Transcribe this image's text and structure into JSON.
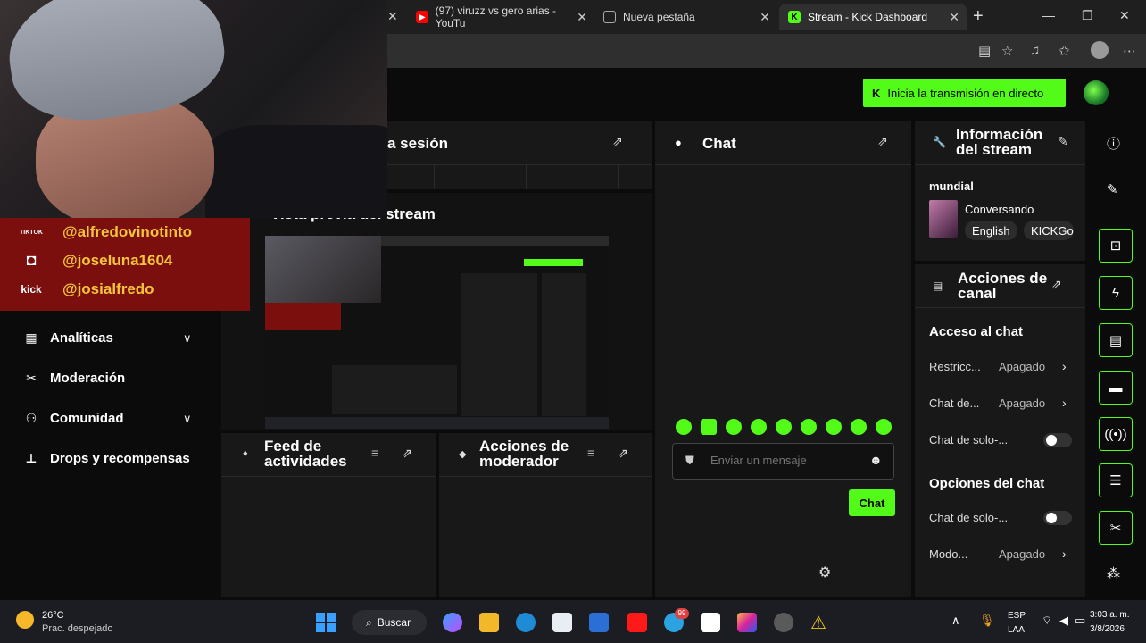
{
  "browser": {
    "tabs": [
      {
        "title": "(97) viruzz vs gero arias - YouTu"
      },
      {
        "title": "Nueva pestaña"
      },
      {
        "title": "Stream - Kick Dashboard"
      }
    ]
  },
  "header": {
    "go_live_label": "Inicia la transmisión en directo"
  },
  "sidebar": {
    "items": [
      {
        "label": "Analíticas",
        "expandable": true
      },
      {
        "label": "Moderación",
        "expandable": false
      },
      {
        "label": "Comunidad",
        "expandable": true
      },
      {
        "label": "Drops y recompensas",
        "expandable": false
      }
    ]
  },
  "panels": {
    "session_title": "a sesión",
    "preview_title": "Vista previa del stream",
    "chat_title": "Chat",
    "activity_title": "Feed de actividades",
    "mod_actions_title": "Acciones de moderador",
    "stream_info_title": "Información del stream",
    "channel_actions_title": "Acciones de canal"
  },
  "stream_info": {
    "title": "mundial",
    "category": "Conversando",
    "tags": [
      "English",
      "KICKGo"
    ]
  },
  "channel_actions": {
    "chat_access_heading": "Acceso al chat",
    "chat_access_rows": [
      {
        "label": "Restricc...",
        "value": "Apagado",
        "type": "chevron"
      },
      {
        "label": "Chat de...",
        "value": "Apagado",
        "type": "chevron"
      },
      {
        "label": "Chat de solo-...",
        "value": "",
        "type": "toggle"
      }
    ],
    "chat_options_heading": "Opciones del chat",
    "chat_options_rows": [
      {
        "label": "Chat de solo-...",
        "value": "",
        "type": "toggle"
      },
      {
        "label": "Modo...",
        "value": "Apagado",
        "type": "chevron"
      }
    ]
  },
  "chat": {
    "placeholder": "Enviar un mensaje",
    "send_label": "Chat"
  },
  "overlay": {
    "socials": [
      {
        "platform": "TIKTOK",
        "handle": "@alfredovinotinto"
      },
      {
        "platform": "instagram",
        "handle": "@joseluna1604"
      },
      {
        "platform": "kick",
        "handle": "@josialfredo"
      }
    ]
  },
  "taskbar": {
    "weather_temp": "26°C",
    "weather_desc": "Prac. despejado",
    "search_label": "Buscar",
    "lang_line1": "ESP",
    "lang_line2": "LAA",
    "time": "3:03 a. m.",
    "date": "3/8/2026",
    "telegram_badge": "99"
  },
  "colors": {
    "kick_green": "#53fc18",
    "panel_bg": "#181818",
    "app_bg": "#0b0b0b",
    "overlay_red": "#7a0f0d",
    "overlay_text": "#f4c53a"
  }
}
